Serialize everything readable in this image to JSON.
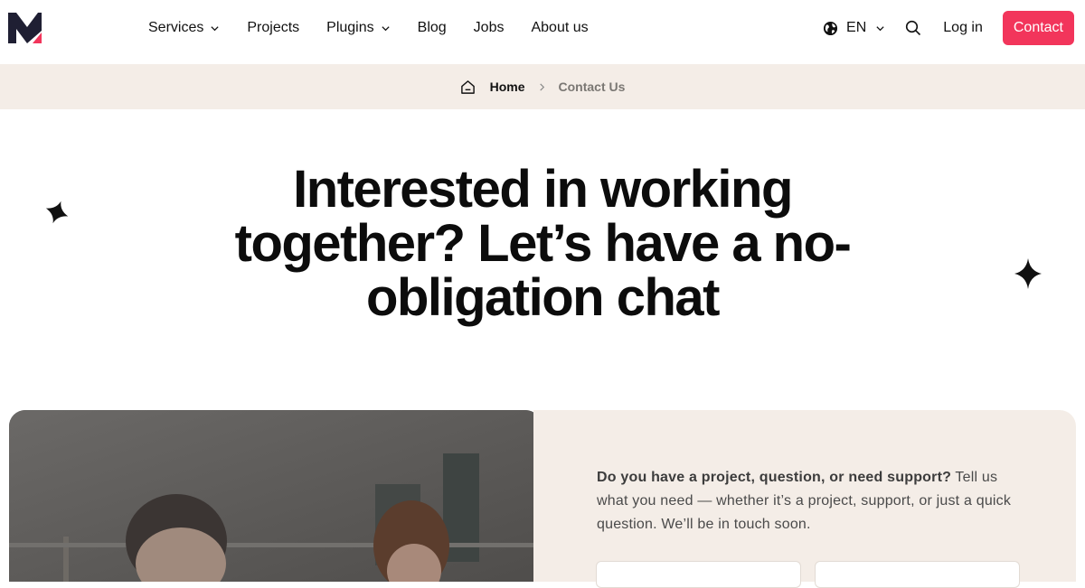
{
  "header": {
    "nav": [
      {
        "label": "Services",
        "dropdown": true
      },
      {
        "label": "Projects",
        "dropdown": false
      },
      {
        "label": "Plugins",
        "dropdown": true
      },
      {
        "label": "Blog",
        "dropdown": false
      },
      {
        "label": "Jobs",
        "dropdown": false
      },
      {
        "label": "About us",
        "dropdown": false
      }
    ],
    "language": "EN",
    "login_label": "Log in",
    "contact_label": "Contact"
  },
  "breadcrumb": {
    "home": "Home",
    "current": "Contact Us"
  },
  "hero": {
    "title": "Interested in working together? Let’s have a no-obligation chat"
  },
  "intro": {
    "bold": "Do you have a project, question, or need support?",
    "text": " Tell us what you need — whether it’s a project, support, or just a quick question. We’ll be in touch soon."
  },
  "colors": {
    "accent": "#f2355b",
    "beige": "#f4ede7",
    "logo_dark": "#1f1f33"
  }
}
